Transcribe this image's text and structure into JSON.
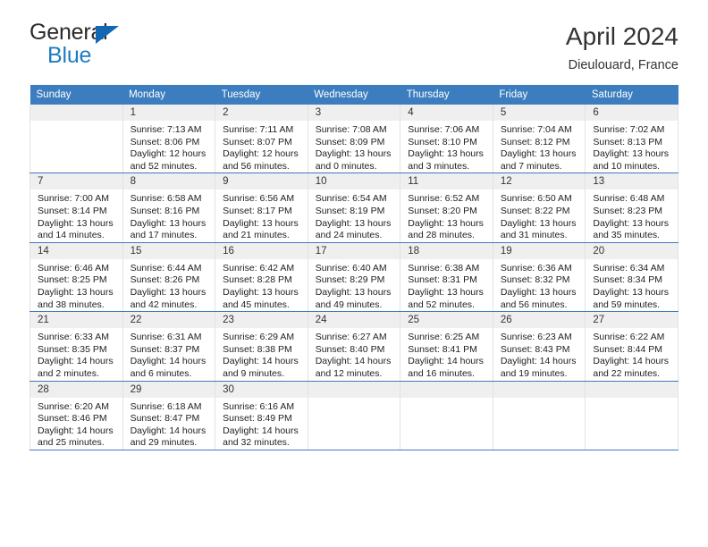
{
  "logo": {
    "word1": "General",
    "word2": "Blue",
    "triangle_color": "#1268b3",
    "blue_color": "#1f7bc1"
  },
  "header": {
    "title": "April 2024",
    "location": "Dieulouard, France"
  },
  "theme": {
    "header_blue": "#3c7dbf",
    "daynum_gray": "#efefef",
    "cell_border": "#e2e2e2"
  },
  "weekday_headers": [
    "Sunday",
    "Monday",
    "Tuesday",
    "Wednesday",
    "Thursday",
    "Friday",
    "Saturday"
  ],
  "weeks": [
    [
      {
        "day": "",
        "sunrise": "",
        "sunset": "",
        "daylight_l1": "",
        "daylight_l2": ""
      },
      {
        "day": "1",
        "sunrise": "Sunrise: 7:13 AM",
        "sunset": "Sunset: 8:06 PM",
        "daylight_l1": "Daylight: 12 hours",
        "daylight_l2": "and 52 minutes."
      },
      {
        "day": "2",
        "sunrise": "Sunrise: 7:11 AM",
        "sunset": "Sunset: 8:07 PM",
        "daylight_l1": "Daylight: 12 hours",
        "daylight_l2": "and 56 minutes."
      },
      {
        "day": "3",
        "sunrise": "Sunrise: 7:08 AM",
        "sunset": "Sunset: 8:09 PM",
        "daylight_l1": "Daylight: 13 hours",
        "daylight_l2": "and 0 minutes."
      },
      {
        "day": "4",
        "sunrise": "Sunrise: 7:06 AM",
        "sunset": "Sunset: 8:10 PM",
        "daylight_l1": "Daylight: 13 hours",
        "daylight_l2": "and 3 minutes."
      },
      {
        "day": "5",
        "sunrise": "Sunrise: 7:04 AM",
        "sunset": "Sunset: 8:12 PM",
        "daylight_l1": "Daylight: 13 hours",
        "daylight_l2": "and 7 minutes."
      },
      {
        "day": "6",
        "sunrise": "Sunrise: 7:02 AM",
        "sunset": "Sunset: 8:13 PM",
        "daylight_l1": "Daylight: 13 hours",
        "daylight_l2": "and 10 minutes."
      }
    ],
    [
      {
        "day": "7",
        "sunrise": "Sunrise: 7:00 AM",
        "sunset": "Sunset: 8:14 PM",
        "daylight_l1": "Daylight: 13 hours",
        "daylight_l2": "and 14 minutes."
      },
      {
        "day": "8",
        "sunrise": "Sunrise: 6:58 AM",
        "sunset": "Sunset: 8:16 PM",
        "daylight_l1": "Daylight: 13 hours",
        "daylight_l2": "and 17 minutes."
      },
      {
        "day": "9",
        "sunrise": "Sunrise: 6:56 AM",
        "sunset": "Sunset: 8:17 PM",
        "daylight_l1": "Daylight: 13 hours",
        "daylight_l2": "and 21 minutes."
      },
      {
        "day": "10",
        "sunrise": "Sunrise: 6:54 AM",
        "sunset": "Sunset: 8:19 PM",
        "daylight_l1": "Daylight: 13 hours",
        "daylight_l2": "and 24 minutes."
      },
      {
        "day": "11",
        "sunrise": "Sunrise: 6:52 AM",
        "sunset": "Sunset: 8:20 PM",
        "daylight_l1": "Daylight: 13 hours",
        "daylight_l2": "and 28 minutes."
      },
      {
        "day": "12",
        "sunrise": "Sunrise: 6:50 AM",
        "sunset": "Sunset: 8:22 PM",
        "daylight_l1": "Daylight: 13 hours",
        "daylight_l2": "and 31 minutes."
      },
      {
        "day": "13",
        "sunrise": "Sunrise: 6:48 AM",
        "sunset": "Sunset: 8:23 PM",
        "daylight_l1": "Daylight: 13 hours",
        "daylight_l2": "and 35 minutes."
      }
    ],
    [
      {
        "day": "14",
        "sunrise": "Sunrise: 6:46 AM",
        "sunset": "Sunset: 8:25 PM",
        "daylight_l1": "Daylight: 13 hours",
        "daylight_l2": "and 38 minutes."
      },
      {
        "day": "15",
        "sunrise": "Sunrise: 6:44 AM",
        "sunset": "Sunset: 8:26 PM",
        "daylight_l1": "Daylight: 13 hours",
        "daylight_l2": "and 42 minutes."
      },
      {
        "day": "16",
        "sunrise": "Sunrise: 6:42 AM",
        "sunset": "Sunset: 8:28 PM",
        "daylight_l1": "Daylight: 13 hours",
        "daylight_l2": "and 45 minutes."
      },
      {
        "day": "17",
        "sunrise": "Sunrise: 6:40 AM",
        "sunset": "Sunset: 8:29 PM",
        "daylight_l1": "Daylight: 13 hours",
        "daylight_l2": "and 49 minutes."
      },
      {
        "day": "18",
        "sunrise": "Sunrise: 6:38 AM",
        "sunset": "Sunset: 8:31 PM",
        "daylight_l1": "Daylight: 13 hours",
        "daylight_l2": "and 52 minutes."
      },
      {
        "day": "19",
        "sunrise": "Sunrise: 6:36 AM",
        "sunset": "Sunset: 8:32 PM",
        "daylight_l1": "Daylight: 13 hours",
        "daylight_l2": "and 56 minutes."
      },
      {
        "day": "20",
        "sunrise": "Sunrise: 6:34 AM",
        "sunset": "Sunset: 8:34 PM",
        "daylight_l1": "Daylight: 13 hours",
        "daylight_l2": "and 59 minutes."
      }
    ],
    [
      {
        "day": "21",
        "sunrise": "Sunrise: 6:33 AM",
        "sunset": "Sunset: 8:35 PM",
        "daylight_l1": "Daylight: 14 hours",
        "daylight_l2": "and 2 minutes."
      },
      {
        "day": "22",
        "sunrise": "Sunrise: 6:31 AM",
        "sunset": "Sunset: 8:37 PM",
        "daylight_l1": "Daylight: 14 hours",
        "daylight_l2": "and 6 minutes."
      },
      {
        "day": "23",
        "sunrise": "Sunrise: 6:29 AM",
        "sunset": "Sunset: 8:38 PM",
        "daylight_l1": "Daylight: 14 hours",
        "daylight_l2": "and 9 minutes."
      },
      {
        "day": "24",
        "sunrise": "Sunrise: 6:27 AM",
        "sunset": "Sunset: 8:40 PM",
        "daylight_l1": "Daylight: 14 hours",
        "daylight_l2": "and 12 minutes."
      },
      {
        "day": "25",
        "sunrise": "Sunrise: 6:25 AM",
        "sunset": "Sunset: 8:41 PM",
        "daylight_l1": "Daylight: 14 hours",
        "daylight_l2": "and 16 minutes."
      },
      {
        "day": "26",
        "sunrise": "Sunrise: 6:23 AM",
        "sunset": "Sunset: 8:43 PM",
        "daylight_l1": "Daylight: 14 hours",
        "daylight_l2": "and 19 minutes."
      },
      {
        "day": "27",
        "sunrise": "Sunrise: 6:22 AM",
        "sunset": "Sunset: 8:44 PM",
        "daylight_l1": "Daylight: 14 hours",
        "daylight_l2": "and 22 minutes."
      }
    ],
    [
      {
        "day": "28",
        "sunrise": "Sunrise: 6:20 AM",
        "sunset": "Sunset: 8:46 PM",
        "daylight_l1": "Daylight: 14 hours",
        "daylight_l2": "and 25 minutes."
      },
      {
        "day": "29",
        "sunrise": "Sunrise: 6:18 AM",
        "sunset": "Sunset: 8:47 PM",
        "daylight_l1": "Daylight: 14 hours",
        "daylight_l2": "and 29 minutes."
      },
      {
        "day": "30",
        "sunrise": "Sunrise: 6:16 AM",
        "sunset": "Sunset: 8:49 PM",
        "daylight_l1": "Daylight: 14 hours",
        "daylight_l2": "and 32 minutes."
      },
      {
        "day": "",
        "sunrise": "",
        "sunset": "",
        "daylight_l1": "",
        "daylight_l2": ""
      },
      {
        "day": "",
        "sunrise": "",
        "sunset": "",
        "daylight_l1": "",
        "daylight_l2": ""
      },
      {
        "day": "",
        "sunrise": "",
        "sunset": "",
        "daylight_l1": "",
        "daylight_l2": ""
      },
      {
        "day": "",
        "sunrise": "",
        "sunset": "",
        "daylight_l1": "",
        "daylight_l2": ""
      }
    ]
  ]
}
